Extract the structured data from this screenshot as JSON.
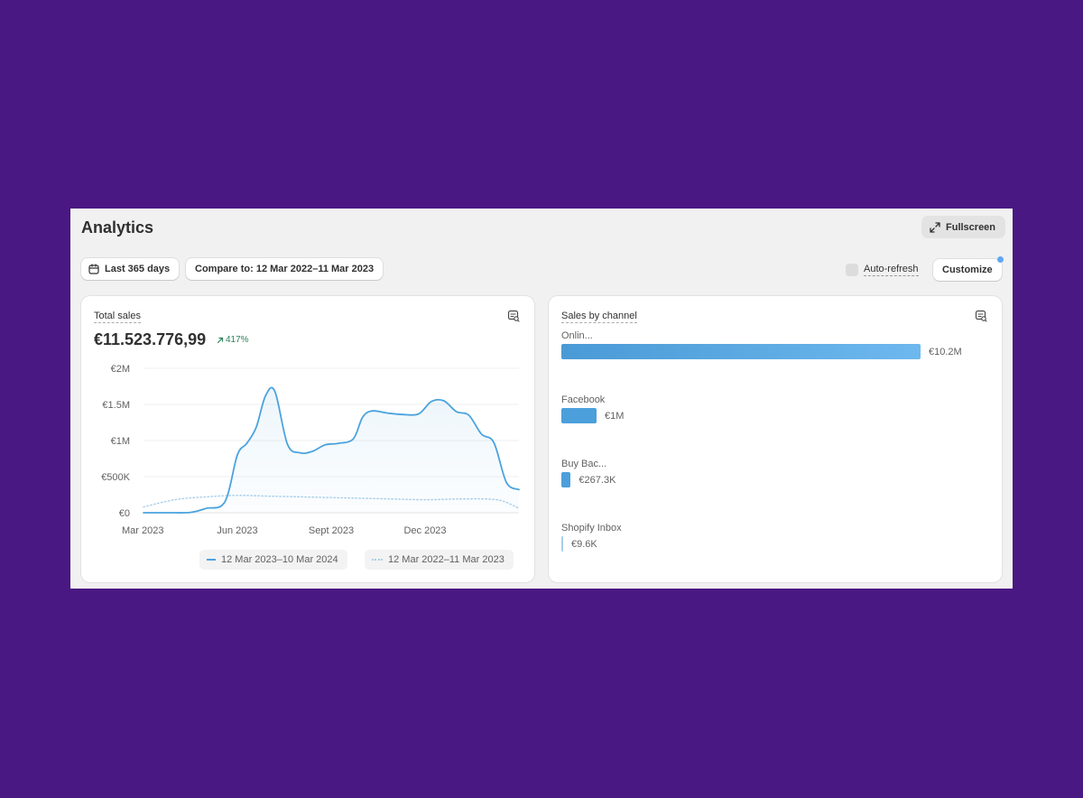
{
  "page": {
    "title": "Analytics",
    "fullscreen_label": "Fullscreen",
    "date_range_label": "Last 365 days",
    "compare_label": "Compare to: 12 Mar 2022–11 Mar 2023",
    "auto_refresh_label": "Auto-refresh",
    "customize_label": "Customize"
  },
  "colors": {
    "accent": "#4ba3de",
    "growth": "#29845a",
    "background": "#4a1883"
  },
  "icons": {
    "fullscreen": "expand-arrows-icon",
    "calendar": "calendar-icon",
    "explore": "chart-explore-icon"
  },
  "total_sales": {
    "title": "Total sales",
    "value": "€11.523.776,99",
    "growth": "417%",
    "legend_current": "12 Mar 2023–10 Mar 2024",
    "legend_previous": "12 Mar 2022–11 Mar 2023"
  },
  "sales_by_channel": {
    "title": "Sales by channel",
    "channels": [
      {
        "name": "Onlin...",
        "value_label": "€10.2M",
        "value": 10200000
      },
      {
        "name": "Facebook",
        "value_label": "€1M",
        "value": 1000000
      },
      {
        "name": "Buy Bac...",
        "value_label": "€267.3K",
        "value": 267300
      },
      {
        "name": "Shopify Inbox",
        "value_label": "€9.6K",
        "value": 9600
      }
    ]
  },
  "chart_data": [
    {
      "type": "area",
      "title": "Total sales",
      "y_ticks": [
        "€0",
        "€500K",
        "€1M",
        "€1.5M",
        "€2M"
      ],
      "y_tick_values": [
        0,
        500000,
        1000000,
        1500000,
        2000000
      ],
      "x_ticks": [
        "Mar 2023",
        "Jun 2023",
        "Sept 2023",
        "Dec 2023"
      ],
      "x_tick_positions": [
        0,
        3,
        6,
        9
      ],
      "ylim": [
        0,
        2000000
      ],
      "xlim": [
        0,
        12
      ],
      "grid": true,
      "legend": "bottom",
      "series": [
        {
          "name": "12 Mar 2023–10 Mar 2024",
          "style": "solid",
          "x": [
            0,
            0.8,
            1.5,
            2.0,
            2.6,
            3.0,
            3.3,
            3.6,
            3.9,
            4.2,
            4.6,
            5.0,
            5.4,
            5.8,
            6.2,
            6.7,
            7.0,
            7.3,
            7.8,
            8.3,
            8.8,
            9.2,
            9.6,
            10.0,
            10.4,
            10.8,
            11.2,
            11.6,
            12.0
          ],
          "y": [
            0,
            0,
            5000,
            60000,
            150000,
            800000,
            960000,
            1180000,
            1620000,
            1680000,
            950000,
            830000,
            850000,
            940000,
            960000,
            1020000,
            1320000,
            1410000,
            1380000,
            1360000,
            1370000,
            1540000,
            1550000,
            1400000,
            1350000,
            1090000,
            970000,
            420000,
            320000
          ]
        },
        {
          "name": "12 Mar 2022–11 Mar 2023",
          "style": "dotted",
          "x": [
            0,
            1,
            2,
            3,
            4,
            5,
            6,
            7,
            8,
            9,
            10,
            11,
            11.5,
            12
          ],
          "y": [
            80000,
            180000,
            220000,
            240000,
            230000,
            220000,
            210000,
            200000,
            190000,
            180000,
            190000,
            190000,
            160000,
            60000
          ]
        }
      ]
    },
    {
      "type": "bar",
      "orientation": "horizontal",
      "title": "Sales by channel",
      "categories": [
        "Onlin...",
        "Facebook",
        "Buy Bac...",
        "Shopify Inbox"
      ],
      "values": [
        10200000,
        1000000,
        267300,
        9600
      ],
      "value_labels": [
        "€10.2M",
        "€1M",
        "€267.3K",
        "€9.6K"
      ]
    }
  ]
}
